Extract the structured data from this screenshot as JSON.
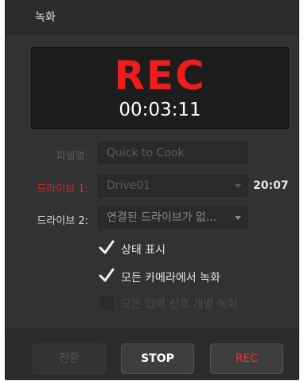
{
  "window": {
    "title": "녹화"
  },
  "display": {
    "status": "REC",
    "timecode": "00:03:11"
  },
  "form": {
    "filename": {
      "label": "파일명:",
      "value": "Quick to Cook"
    },
    "drive1": {
      "label": "드라이브 1:",
      "value": "Drive01",
      "time": "20:07"
    },
    "drive2": {
      "label": "드라이브 2:",
      "value": "연결된 드라이브가 없..."
    }
  },
  "options": [
    {
      "label": "상태 표시",
      "checked": true,
      "enabled": true
    },
    {
      "label": "모든 카메라에서 녹화",
      "checked": true,
      "enabled": true
    },
    {
      "label": "모든 입력 신호 개별 녹화",
      "checked": false,
      "enabled": false
    }
  ],
  "buttons": {
    "switch": "전환",
    "stop": "STOP",
    "rec": "REC"
  },
  "colors": {
    "accent_red": "#ee1c1c",
    "panel": "#323232",
    "display_bg": "#1d1d1d"
  }
}
